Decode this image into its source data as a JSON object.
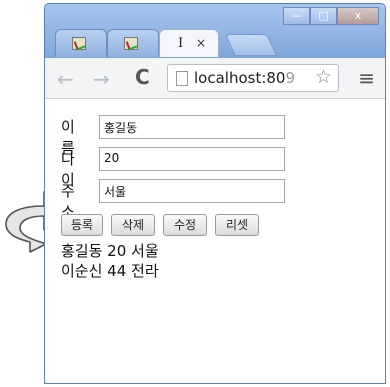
{
  "tabs": [
    {
      "label": ""
    },
    {
      "label": ""
    },
    {
      "label": "I",
      "close": "×"
    }
  ],
  "window_controls": {
    "minimize": "—",
    "maximize": "□",
    "close": "x"
  },
  "toolbar": {
    "back": "←",
    "forward": "→",
    "reload": "C",
    "url": "localhost:80",
    "url_dim": "9",
    "star": "☆",
    "menu": "≡"
  },
  "form": {
    "name": {
      "label": "이름",
      "value": "홍길동"
    },
    "age": {
      "label": "나이",
      "value": "20"
    },
    "address": {
      "label": "주소",
      "value": "서울"
    }
  },
  "buttons": {
    "register": "등록",
    "delete": "삭제",
    "edit": "수정",
    "reset": "리셋"
  },
  "records": [
    {
      "text": "홍길동 20 서울"
    },
    {
      "text": "이순신 44 전라"
    }
  ]
}
